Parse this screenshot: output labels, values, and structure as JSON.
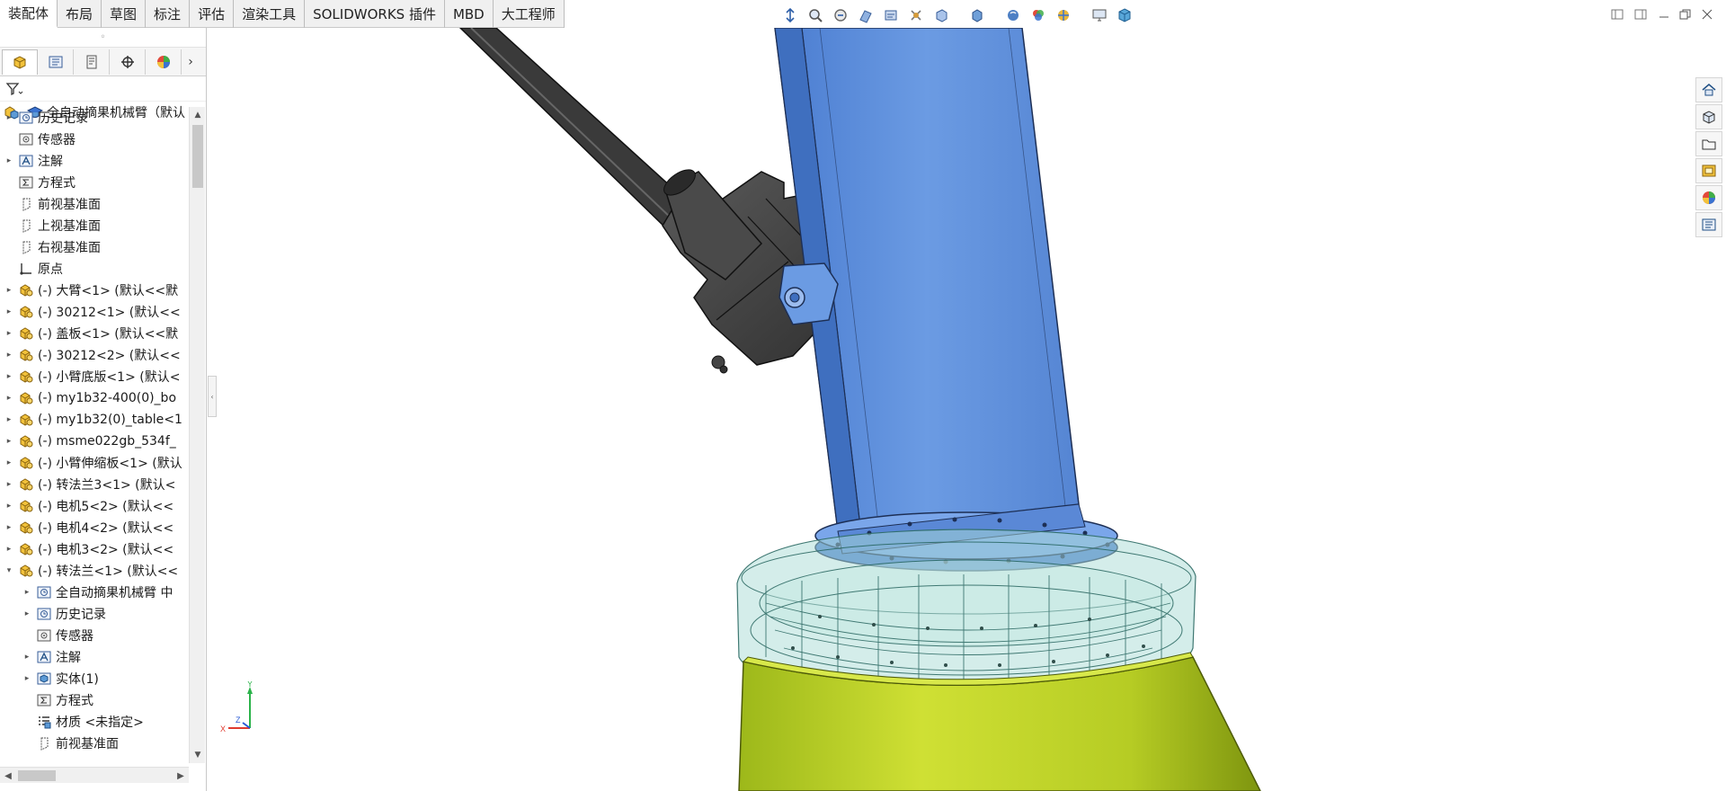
{
  "command_tabs": [
    {
      "label": "装配体",
      "active": true
    },
    {
      "label": "布局",
      "active": false
    },
    {
      "label": "草图",
      "active": false
    },
    {
      "label": "标注",
      "active": false
    },
    {
      "label": "评估",
      "active": false
    },
    {
      "label": "渲染工具",
      "active": false
    },
    {
      "label": "SOLIDWORKS 插件",
      "active": false
    },
    {
      "label": "MBD",
      "active": false
    },
    {
      "label": "大工程师",
      "active": false
    }
  ],
  "feature_tree": {
    "root": "全自动摘果机械臂（默认",
    "rows": [
      {
        "label": "历史记录",
        "icon": "history-icon",
        "expandable": true,
        "level": 0
      },
      {
        "label": "传感器",
        "icon": "sensor-icon",
        "expandable": false,
        "level": 0
      },
      {
        "label": "注解",
        "icon": "annotation-icon",
        "expandable": true,
        "level": 0
      },
      {
        "label": "方程式",
        "icon": "equation-icon",
        "expandable": false,
        "level": 0
      },
      {
        "label": "前视基准面",
        "icon": "plane-icon",
        "expandable": false,
        "level": 0
      },
      {
        "label": "上视基准面",
        "icon": "plane-icon",
        "expandable": false,
        "level": 0
      },
      {
        "label": "右视基准面",
        "icon": "plane-icon",
        "expandable": false,
        "level": 0
      },
      {
        "label": "原点",
        "icon": "origin-icon",
        "expandable": false,
        "level": 0
      },
      {
        "label": "(-) 大臂<1> (默认<<默",
        "icon": "part-icon",
        "expandable": true,
        "level": 0
      },
      {
        "label": "(-) 30212<1> (默认<<",
        "icon": "part-icon",
        "expandable": true,
        "level": 0
      },
      {
        "label": "(-) 盖板<1> (默认<<默",
        "icon": "part-icon",
        "expandable": true,
        "level": 0
      },
      {
        "label": "(-) 30212<2> (默认<<",
        "icon": "part-icon",
        "expandable": true,
        "level": 0
      },
      {
        "label": "(-) 小臂底版<1> (默认<",
        "icon": "part-icon",
        "expandable": true,
        "level": 0
      },
      {
        "label": "(-) my1b32-400(0)_bo",
        "icon": "part-icon",
        "expandable": true,
        "level": 0
      },
      {
        "label": "(-) my1b32(0)_table<1",
        "icon": "part-icon",
        "expandable": true,
        "level": 0
      },
      {
        "label": "(-) msme022gb_534f_",
        "icon": "part-icon",
        "expandable": true,
        "level": 0
      },
      {
        "label": "(-) 小臂伸缩板<1> (默认",
        "icon": "part-icon",
        "expandable": true,
        "level": 0
      },
      {
        "label": "(-) 转法兰3<1> (默认<",
        "icon": "part-icon",
        "expandable": true,
        "level": 0
      },
      {
        "label": "(-) 电机5<2> (默认<<",
        "icon": "part-icon",
        "expandable": true,
        "level": 0
      },
      {
        "label": "(-) 电机4<2> (默认<<",
        "icon": "part-icon",
        "expandable": true,
        "level": 0
      },
      {
        "label": "(-) 电机3<2> (默认<<",
        "icon": "part-icon",
        "expandable": true,
        "level": 0
      },
      {
        "label": "(-) 转法兰<1> (默认<<",
        "icon": "part-icon",
        "expandable": true,
        "expanded": true,
        "level": 0
      },
      {
        "label": "全自动摘果机械臂 中",
        "icon": "history-icon",
        "expandable": true,
        "level": 1
      },
      {
        "label": "历史记录",
        "icon": "history-icon",
        "expandable": true,
        "level": 1
      },
      {
        "label": "传感器",
        "icon": "sensor-icon",
        "expandable": false,
        "level": 1
      },
      {
        "label": "注解",
        "icon": "annotation-icon",
        "expandable": true,
        "level": 1
      },
      {
        "label": "实体(1)",
        "icon": "solid-body-icon",
        "expandable": true,
        "level": 1
      },
      {
        "label": "方程式",
        "icon": "equation-icon",
        "expandable": false,
        "level": 1
      },
      {
        "label": "材质 <未指定>",
        "icon": "material-icon",
        "expandable": false,
        "level": 1
      },
      {
        "label": "前视基准面",
        "icon": "plane-icon",
        "expandable": false,
        "level": 1
      }
    ]
  },
  "triad": {
    "y": "Y",
    "x": "X",
    "z": "Z"
  },
  "colors": {
    "arm_blue": "#5b8fdc",
    "flange_blue": "#6fa0e6",
    "base_yellow": "#b9cf26",
    "motor_dark": "#3c3c3c",
    "glass_teal": "#a9dbd5"
  },
  "toolbar_icons": [
    "zoom-to-fit-icon",
    "zoom-area-icon",
    "previous-view-icon",
    "section-view-icon",
    "dynamic-annotation-icon",
    "view-orientation-icon",
    "display-style-icon",
    "hide-show-icon",
    "edit-appearance-icon",
    "apply-scene-icon",
    "view-settings-icon",
    "3d-view-icon"
  ],
  "task_pane_icons": [
    "home-icon",
    "parts-library-icon",
    "file-explorer-icon",
    "view-palette-icon",
    "appearances-icon",
    "custom-properties-icon"
  ]
}
